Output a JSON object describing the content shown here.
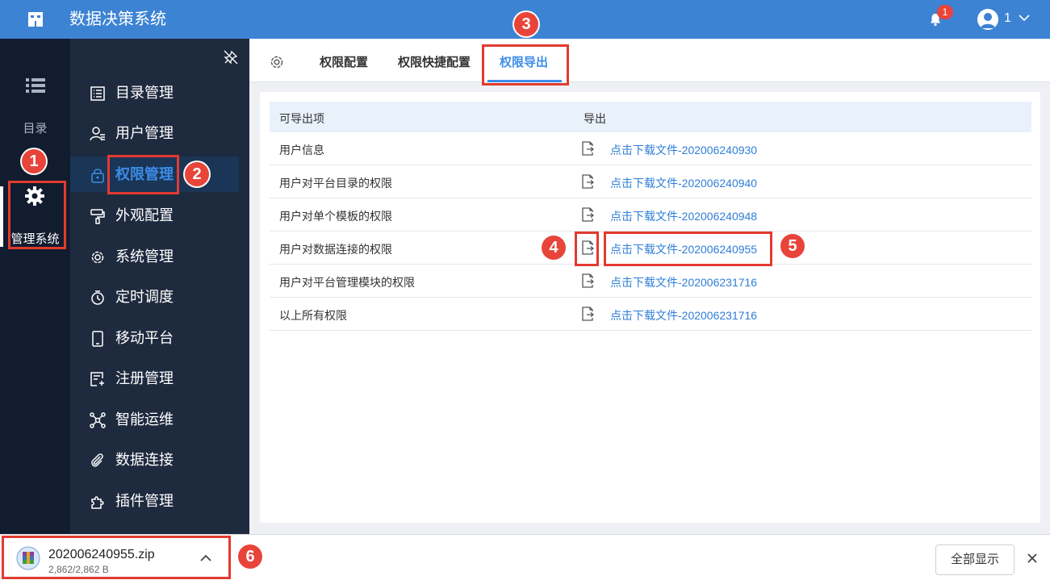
{
  "header": {
    "app_title": "数据决策系统",
    "notification_count": "1",
    "user_name": "1"
  },
  "rail": {
    "directory_label": "目录",
    "management_label": "管理系统"
  },
  "sidebar": {
    "items": [
      {
        "label": "目录管理",
        "icon": "catalog-icon"
      },
      {
        "label": "用户管理",
        "icon": "user-icon"
      },
      {
        "label": "权限管理",
        "icon": "lock-icon",
        "active": true
      },
      {
        "label": "外观配置",
        "icon": "paint-roller-icon"
      },
      {
        "label": "系统管理",
        "icon": "gear-icon"
      },
      {
        "label": "定时调度",
        "icon": "timer-icon"
      },
      {
        "label": "移动平台",
        "icon": "tablet-icon"
      },
      {
        "label": "注册管理",
        "icon": "register-icon"
      },
      {
        "label": "智能运维",
        "icon": "network-icon"
      },
      {
        "label": "数据连接",
        "icon": "paperclip-icon"
      },
      {
        "label": "插件管理",
        "icon": "puzzle-icon"
      }
    ]
  },
  "tabs": {
    "items": [
      {
        "label": "权限配置"
      },
      {
        "label": "权限快捷配置"
      },
      {
        "label": "权限导出",
        "active": true
      }
    ]
  },
  "table": {
    "headers": {
      "item": "可导出项",
      "export": "导出"
    },
    "rows": [
      {
        "name": "用户信息",
        "link": "点击下载文件-202006240930"
      },
      {
        "name": "用户对平台目录的权限",
        "link": "点击下载文件-202006240940"
      },
      {
        "name": "用户对单个模板的权限",
        "link": "点击下载文件-202006240948"
      },
      {
        "name": "用户对数据连接的权限",
        "link": "点击下载文件-202006240955"
      },
      {
        "name": "用户对平台管理模块的权限",
        "link": "点击下载文件-202006231716"
      },
      {
        "name": "以上所有权限",
        "link": "点击下载文件-202006231716"
      }
    ]
  },
  "annotations": [
    "1",
    "2",
    "3",
    "4",
    "5",
    "6"
  ],
  "download": {
    "file_name": "202006240955.zip",
    "size": "2,862/2,862 B",
    "show_all_label": "全部显示"
  },
  "colors": {
    "header_bg": "#3c83d4",
    "rail_bg": "#111c2e",
    "sidebar_bg": "#1e2a3e",
    "accent": "#3c8de8",
    "annotation_red": "#e8443a"
  }
}
